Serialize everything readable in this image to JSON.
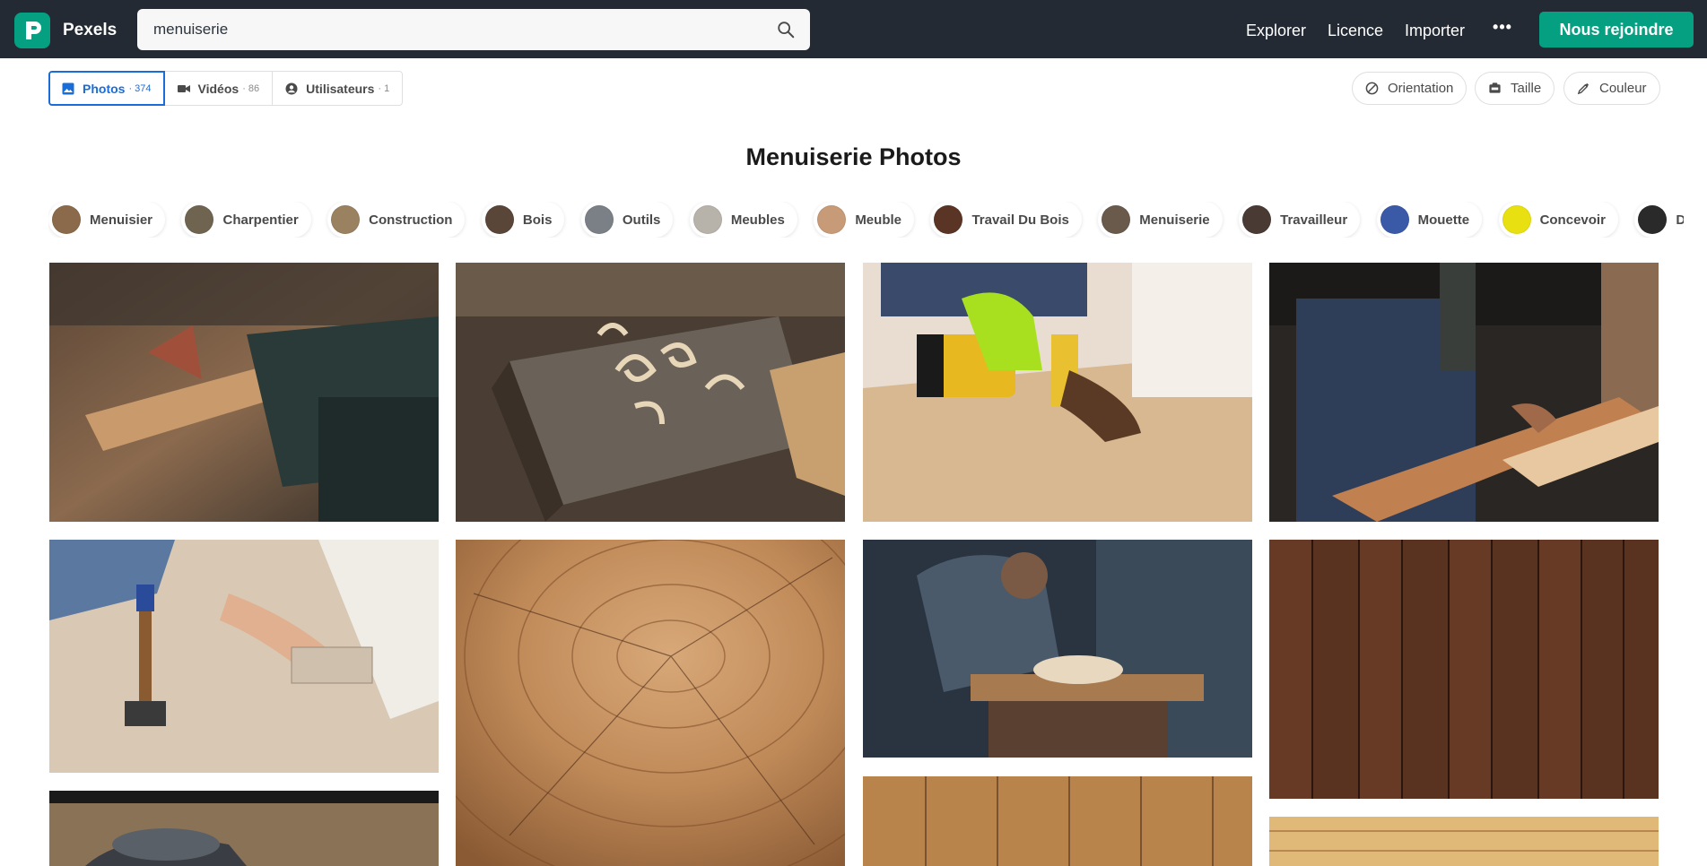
{
  "header": {
    "logo_text": "Pexels",
    "search_value": "menuiserie",
    "nav": {
      "explore": "Explorer",
      "license": "Licence",
      "upload": "Importer",
      "more": "•••"
    },
    "join_label": "Nous rejoindre"
  },
  "tabs": [
    {
      "label": "Photos",
      "count": "· 374",
      "icon": "image-icon",
      "active": true
    },
    {
      "label": "Vidéos",
      "count": "· 86",
      "icon": "video-icon",
      "active": false
    },
    {
      "label": "Utilisateurs",
      "count": "· 1",
      "icon": "user-icon",
      "active": false
    }
  ],
  "filters": {
    "orientation": "Orientation",
    "size": "Taille",
    "color": "Couleur"
  },
  "title": "Menuiserie Photos",
  "chips": [
    {
      "label": "Menuisier",
      "color": "#8a6a4a"
    },
    {
      "label": "Charpentier",
      "color": "#6f6450"
    },
    {
      "label": "Construction",
      "color": "#9a8160"
    },
    {
      "label": "Bois",
      "color": "#5a4638"
    },
    {
      "label": "Outils",
      "color": "#7b7f86"
    },
    {
      "label": "Meubles",
      "color": "#b8b3aa"
    },
    {
      "label": "Meuble",
      "color": "#c79a78"
    },
    {
      "label": "Travail Du Bois",
      "color": "#5a3424"
    },
    {
      "label": "Menuiserie",
      "color": "#6a5a4c"
    },
    {
      "label": "Travailleur",
      "color": "#4a3a34"
    },
    {
      "label": "Mouette",
      "color": "#3a5aa8"
    },
    {
      "label": "Concevoir",
      "color": "#e8e010"
    },
    {
      "label": "Design",
      "color": "#2a2a2a"
    }
  ],
  "colors": {
    "nav_bg": "#232a34",
    "accent": "#05a081",
    "active_tab": "#1a6dd8"
  }
}
